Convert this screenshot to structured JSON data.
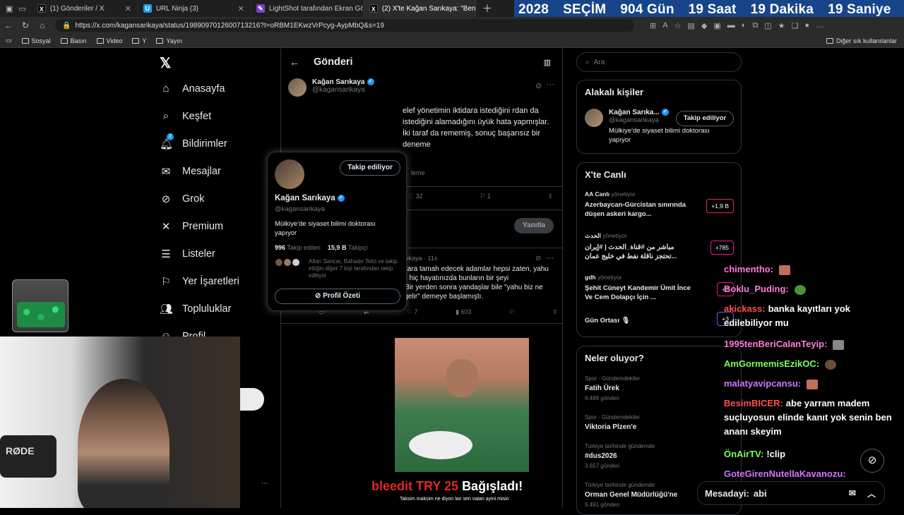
{
  "tabs": [
    {
      "label": "(1) Gönderiler / X",
      "fav": "X",
      "favColor": "#000"
    },
    {
      "label": "URL Ninja (3)",
      "fav": "U",
      "favColor": "#1d9bf0"
    },
    {
      "label": "LightShot tarafından Ekran Görün...",
      "fav": "✎",
      "favColor": "#7a3fd1"
    },
    {
      "label": "(2) X'te Kağan Sarıkaya: \"Ben iddi...",
      "fav": "X",
      "favColor": "#000"
    }
  ],
  "countdown": {
    "year": "2028",
    "word": "SEÇİM",
    "days": "904 Gün",
    "hours": "19 Saat",
    "minutes": "19 Dakika",
    "seconds": "19 Saniye"
  },
  "url": "https://x.com/kagansarikaya/status/1989097012600713216?t=oRBM1EKwzVrPcyg-AypMbQ&s=19",
  "bookmarks": [
    "Sosyal",
    "Basın",
    "Video",
    "Y",
    "Yayın"
  ],
  "bookmarks_right": "Diğer sık kullanılanlar",
  "nav": {
    "items": [
      {
        "label": "Anasayfa",
        "icon": "home-icon"
      },
      {
        "label": "Keşfet",
        "icon": "search-icon"
      },
      {
        "label": "Bildirimler",
        "icon": "bell-icon"
      },
      {
        "label": "Mesajlar",
        "icon": "mail-icon"
      },
      {
        "label": "Grok",
        "icon": "grok-icon"
      },
      {
        "label": "Premium",
        "icon": "x-icon"
      },
      {
        "label": "Listeler",
        "icon": "list-icon"
      },
      {
        "label": "Yer İşaretleri",
        "icon": "bookmark-icon"
      },
      {
        "label": "Topluluklar",
        "icon": "people-icon"
      },
      {
        "label": "Profil",
        "icon": "person-icon"
      }
    ],
    "notif_badge": "2"
  },
  "post": {
    "header": "Gönderi",
    "author_name": "Kağan Sarıkaya",
    "author_handle": "@kagansarikaya",
    "text": "elef yönetimin iktidara istediğini rdan da istediğini alamadığını üyük hata yapmışlar. İki taraf da rememiş, sonuç başarısız bir deneme",
    "meta": "leme",
    "likes": "32",
    "bookmarks": "1",
    "reply_label": "Yanıtla"
  },
  "popup": {
    "follow_label": "Takip ediliyor",
    "name": "Kağan Sarıkaya",
    "handle": "@kagansarikaya",
    "bio": "Mülkiye'de siyaset bilimi doktorası yapıyor",
    "following_count": "996",
    "following_label": "Takip edilen",
    "followers_count": "15,9 B",
    "followers_label": "Takipçi",
    "followed_by": "Altan Sancar, Bahadır Telci ve takip ettiğin diğer 7 kişi tarafından takip ediliyor",
    "profile_summary": "Profil Özeti"
  },
  "reply": {
    "head": "arıkaya · 11s",
    "text": "Hadi bunlar sizle iş tuttu, iki çıkara tamah edecek adamlar hepsi zaten, yahu siz niye onlarla iş tuttunuz? Siz hiç hayatınızda bunların bir şeyi başarabildiğini gördünüz mü? Bir yerden sonra yandaşlar bile \"yahu biz ne yapıyoruz bunlardan hayır mı gelir\" demeye başlamıştı.",
    "likes": "7",
    "views": "603"
  },
  "video_overlay": {
    "red": "bleedit TRY 25",
    "white": "Bağışladı!",
    "sub": "Taksim maksim ne diyon lan sen vatan ayini misin"
  },
  "right": {
    "search_placeholder": "Ara",
    "related_title": "Alakalı kişiler",
    "related": {
      "name": "Kağan Sarıka...",
      "handle": "@kagansarikaya",
      "bio": "Mülkiye'de siyaset bilimi doktorası yapıyor",
      "follow_label": "Takip ediliyor"
    },
    "live_title": "X'te Canlı",
    "live": [
      {
        "source": "AA Canlı",
        "status": "yönetiyor",
        "text": "Azerbaycan-Gürcistan sınırında düşen askeri kargo...",
        "count": "+1,9 B"
      },
      {
        "source": "الحدث",
        "status": "yönetiyor",
        "text": "مباشر من #قناة_الحدث | #إيران تحتجز ناقلة نفط في خليج عمان...",
        "count": "+785"
      },
      {
        "source": "gdh",
        "status": "yönetiyor",
        "text": "Şehit Cüneyt Kandemir Ümit İnce Ve Cem Dolapçı İçin ...",
        "count": "+2"
      },
      {
        "source": "",
        "status": "",
        "text": "Gün Ortası 🎙",
        "count": "+3"
      }
    ],
    "trends_title": "Neler oluyor?",
    "trends": [
      {
        "category": "Spor · Gündemdekiler",
        "name": "Fatih Ürek",
        "posts": "6.489 gönderi"
      },
      {
        "category": "Spor · Gündemdekiler",
        "name": "Viktoria Plzen'e",
        "posts": ""
      },
      {
        "category": "Türkiye tarihinde gündemde",
        "name": "#dus2026",
        "posts": "3.657 gönderi"
      },
      {
        "category": "Türkiye tarihinde gündemde",
        "name": "Orman Genel Müdürlüğü'ne",
        "posts": "5.491 gönderi"
      }
    ]
  },
  "chat": [
    {
      "user": "chimentho:",
      "color": "#ff7ad9",
      "msg": ""
    },
    {
      "user": "Boklu_Puding:",
      "color": "#ff7ad9",
      "msg": ""
    },
    {
      "user": "akickass:",
      "color": "#ff4f4f",
      "msg": "banka kayıtları yok edilebiliyor mu"
    },
    {
      "user": "1995tenBeriCalanTeyip:",
      "color": "#ff7ad9",
      "msg": ""
    },
    {
      "user": "AmGormemisEzikOC:",
      "color": "#7cff5a",
      "msg": ""
    },
    {
      "user": "malatyavipcansu:",
      "color": "#d277ff",
      "msg": ""
    },
    {
      "user": "BesimBICER:",
      "color": "#ff4f4f",
      "msg": "abe yarram madem suçluyosun elinde kanıt yok senin ben ananı skeyim"
    },
    {
      "user": "ÖnAirTV:",
      "color": "#7cff5a",
      "msg": "!clip"
    },
    {
      "user": "GoteGirenNutellaKavanozu:",
      "color": "#d277ff",
      "msg": ""
    },
    {
      "user": "Mesadayi:",
      "color": "#ffffff",
      "msg": "abi"
    }
  ],
  "webcam_label": "RØDE"
}
